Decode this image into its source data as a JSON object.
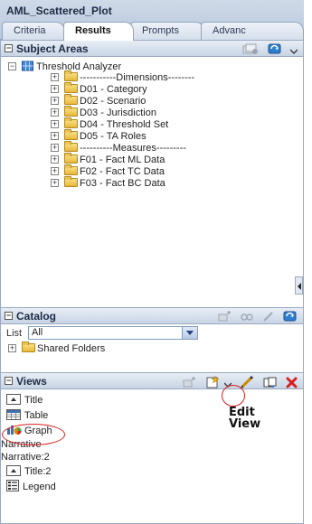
{
  "report_title": "AML_Scattered_Plot",
  "tabs": [
    {
      "label": "Criteria",
      "active": false
    },
    {
      "label": "Results",
      "active": true
    },
    {
      "label": "Prompts",
      "active": false
    },
    {
      "label": "Advanc",
      "active": false
    }
  ],
  "subject_areas": {
    "title": "Subject Areas",
    "root": "Threshold Analyzer",
    "items": [
      "-----------Dimensions--------",
      "D01 - Category",
      "D02 - Scenario",
      "D03 - Jurisdiction",
      "D04 - Threshold Set",
      "D05 - TA Roles",
      "----------Measures---------",
      "F01 - Fact ML Data",
      "F02 - Fact TC Data",
      "F03 - Fact BC Data"
    ]
  },
  "catalog": {
    "title": "Catalog",
    "list_label": "List",
    "list_value": "All",
    "items": [
      "Shared Folders"
    ]
  },
  "views": {
    "title": "Views",
    "items": [
      {
        "label": "Title",
        "icon": "title-view-icon"
      },
      {
        "label": "Table",
        "icon": "table-view-icon"
      },
      {
        "label": "Graph",
        "icon": "graph-view-icon"
      },
      {
        "label": "Narrative",
        "icon": ""
      },
      {
        "label": "Narrative:2",
        "icon": ""
      },
      {
        "label": "Title:2",
        "icon": "title-view-icon"
      },
      {
        "label": "Legend",
        "icon": "legend-view-icon"
      }
    ]
  },
  "annotation": {
    "line1": "Edit",
    "line2": "View",
    "color": "#d62020"
  },
  "colors": {
    "header_bg": "#c8d4e4",
    "folder": "#e9b83a",
    "delete": "#d62020"
  }
}
